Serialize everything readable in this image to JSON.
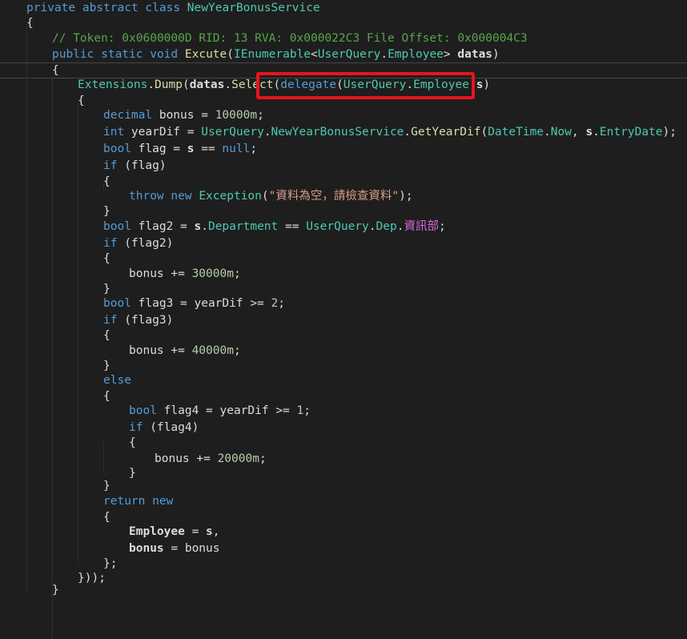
{
  "editor": {
    "lines": [
      [
        {
          "t": "private abstract class ",
          "c": "kw"
        },
        {
          "t": "NewYearBonusService",
          "c": "typ"
        }
      ],
      [
        {
          "t": "{",
          "c": "pln"
        }
      ],
      [
        {
          "t": "// Token: 0x0600000D RID: 13 RVA: 0x000022C3 File Offset: 0x000004C3",
          "c": "cmt"
        }
      ],
      [
        {
          "t": "public static void ",
          "c": "kw"
        },
        {
          "t": "Excute",
          "c": "mth"
        },
        {
          "t": "(",
          "c": "pln"
        },
        {
          "t": "IEnumerable",
          "c": "typ"
        },
        {
          "t": "<",
          "c": "pln"
        },
        {
          "t": "UserQuery",
          "c": "typ"
        },
        {
          "t": ".",
          "c": "pln"
        },
        {
          "t": "Employee",
          "c": "typ"
        },
        {
          "t": "> ",
          "c": "pln"
        },
        {
          "t": "datas",
          "c": "var"
        },
        {
          "t": ")",
          "c": "pln"
        }
      ],
      [
        {
          "t": "{",
          "c": "pln"
        }
      ],
      [
        {
          "t": "Extensions",
          "c": "typ"
        },
        {
          "t": ".",
          "c": "pln"
        },
        {
          "t": "Dump",
          "c": "mth"
        },
        {
          "t": "(",
          "c": "pln"
        },
        {
          "t": "datas",
          "c": "var"
        },
        {
          "t": ".",
          "c": "pln"
        },
        {
          "t": "Selec",
          "c": "mth"
        },
        {
          "t": "t",
          "c": "mth"
        },
        {
          "t": "(",
          "c": "pln"
        },
        {
          "t": "delegate",
          "c": "kw"
        },
        {
          "t": "(",
          "c": "pln"
        },
        {
          "t": "UserQuery",
          "c": "typ"
        },
        {
          "t": ".",
          "c": "pln"
        },
        {
          "t": "Employee",
          "c": "typ"
        },
        {
          "t": " ",
          "c": "pln"
        },
        {
          "t": "s",
          "c": "var"
        },
        {
          "t": ")",
          "c": "pln"
        }
      ],
      [
        {
          "t": "{",
          "c": "pln"
        }
      ],
      [
        {
          "t": "decimal ",
          "c": "kw"
        },
        {
          "t": "bonus = ",
          "c": "pln"
        },
        {
          "t": "10000m",
          "c": "num"
        },
        {
          "t": ";",
          "c": "pln"
        }
      ],
      [
        {
          "t": "int ",
          "c": "kw"
        },
        {
          "t": "yearDif = ",
          "c": "pln"
        },
        {
          "t": "UserQuery",
          "c": "typ"
        },
        {
          "t": ".",
          "c": "pln"
        },
        {
          "t": "NewYearBonusService",
          "c": "typ"
        },
        {
          "t": ".",
          "c": "pln"
        },
        {
          "t": "GetYearDif",
          "c": "mth"
        },
        {
          "t": "(",
          "c": "pln"
        },
        {
          "t": "DateTime",
          "c": "typ"
        },
        {
          "t": ".",
          "c": "pln"
        },
        {
          "t": "Now",
          "c": "prp"
        },
        {
          "t": ", ",
          "c": "pln"
        },
        {
          "t": "s",
          "c": "var"
        },
        {
          "t": ".",
          "c": "pln"
        },
        {
          "t": "EntryDate",
          "c": "prp"
        },
        {
          "t": ");",
          "c": "pln"
        }
      ],
      [
        {
          "t": "bool ",
          "c": "kw"
        },
        {
          "t": "flag = ",
          "c": "pln"
        },
        {
          "t": "s",
          "c": "var"
        },
        {
          "t": " == ",
          "c": "pln"
        },
        {
          "t": "null",
          "c": "kw"
        },
        {
          "t": ";",
          "c": "pln"
        }
      ],
      [
        {
          "t": "if ",
          "c": "kw"
        },
        {
          "t": "(flag)",
          "c": "pln"
        }
      ],
      [
        {
          "t": "{",
          "c": "pln"
        }
      ],
      [
        {
          "t": "throw new ",
          "c": "kw"
        },
        {
          "t": "Exception",
          "c": "typ"
        },
        {
          "t": "(",
          "c": "pln"
        },
        {
          "t": "\"資料為空，請檢查資料\"",
          "c": "str"
        },
        {
          "t": ");",
          "c": "pln"
        }
      ],
      [
        {
          "t": "}",
          "c": "pln"
        }
      ],
      [
        {
          "t": "bool ",
          "c": "kw"
        },
        {
          "t": "flag2 = ",
          "c": "pln"
        },
        {
          "t": "s",
          "c": "var"
        },
        {
          "t": ".",
          "c": "pln"
        },
        {
          "t": "Department",
          "c": "prp"
        },
        {
          "t": " == ",
          "c": "pln"
        },
        {
          "t": "UserQuery",
          "c": "typ"
        },
        {
          "t": ".",
          "c": "pln"
        },
        {
          "t": "Dep",
          "c": "typ"
        },
        {
          "t": ".",
          "c": "pln"
        },
        {
          "t": "資訊部",
          "c": "mag"
        },
        {
          "t": ";",
          "c": "pln"
        }
      ],
      [
        {
          "t": "if ",
          "c": "kw"
        },
        {
          "t": "(flag2)",
          "c": "pln"
        }
      ],
      [
        {
          "t": "{",
          "c": "pln"
        }
      ],
      [
        {
          "t": "bonus += ",
          "c": "pln"
        },
        {
          "t": "30000m",
          "c": "num"
        },
        {
          "t": ";",
          "c": "pln"
        }
      ],
      [
        {
          "t": "}",
          "c": "pln"
        }
      ],
      [
        {
          "t": "bool ",
          "c": "kw"
        },
        {
          "t": "flag3 = yearDif >= ",
          "c": "pln"
        },
        {
          "t": "2",
          "c": "num"
        },
        {
          "t": ";",
          "c": "pln"
        }
      ],
      [
        {
          "t": "if ",
          "c": "kw"
        },
        {
          "t": "(flag3)",
          "c": "pln"
        }
      ],
      [
        {
          "t": "{",
          "c": "pln"
        }
      ],
      [
        {
          "t": "bonus += ",
          "c": "pln"
        },
        {
          "t": "40000m",
          "c": "num"
        },
        {
          "t": ";",
          "c": "pln"
        }
      ],
      [
        {
          "t": "}",
          "c": "pln"
        }
      ],
      [
        {
          "t": "else",
          "c": "kw"
        }
      ],
      [
        {
          "t": "{",
          "c": "pln"
        }
      ],
      [
        {
          "t": "bool ",
          "c": "kw"
        },
        {
          "t": "flag4 = yearDif >= ",
          "c": "pln"
        },
        {
          "t": "1",
          "c": "num"
        },
        {
          "t": ";",
          "c": "pln"
        }
      ],
      [
        {
          "t": "if ",
          "c": "kw"
        },
        {
          "t": "(flag4)",
          "c": "pln"
        }
      ],
      [
        {
          "t": "{",
          "c": "pln"
        }
      ],
      [
        {
          "t": "bonus += ",
          "c": "pln"
        },
        {
          "t": "20000m",
          "c": "num"
        },
        {
          "t": ";",
          "c": "pln"
        }
      ],
      [
        {
          "t": "}",
          "c": "pln"
        }
      ],
      [
        {
          "t": "}",
          "c": "pln"
        }
      ],
      [
        {
          "t": "return new",
          "c": "kw"
        }
      ],
      [
        {
          "t": "{",
          "c": "pln"
        }
      ],
      [
        {
          "t": "Employee",
          "c": "var"
        },
        {
          "t": " = ",
          "c": "pln"
        },
        {
          "t": "s",
          "c": "var"
        },
        {
          "t": ",",
          "c": "pln"
        }
      ],
      [
        {
          "t": "bonus",
          "c": "var"
        },
        {
          "t": " = bonus",
          "c": "pln"
        }
      ],
      [
        {
          "t": "};",
          "c": "pln"
        }
      ],
      [
        {
          "t": "}));",
          "c": "pln"
        }
      ],
      [
        {
          "t": "}",
          "c": "pln"
        }
      ]
    ]
  }
}
